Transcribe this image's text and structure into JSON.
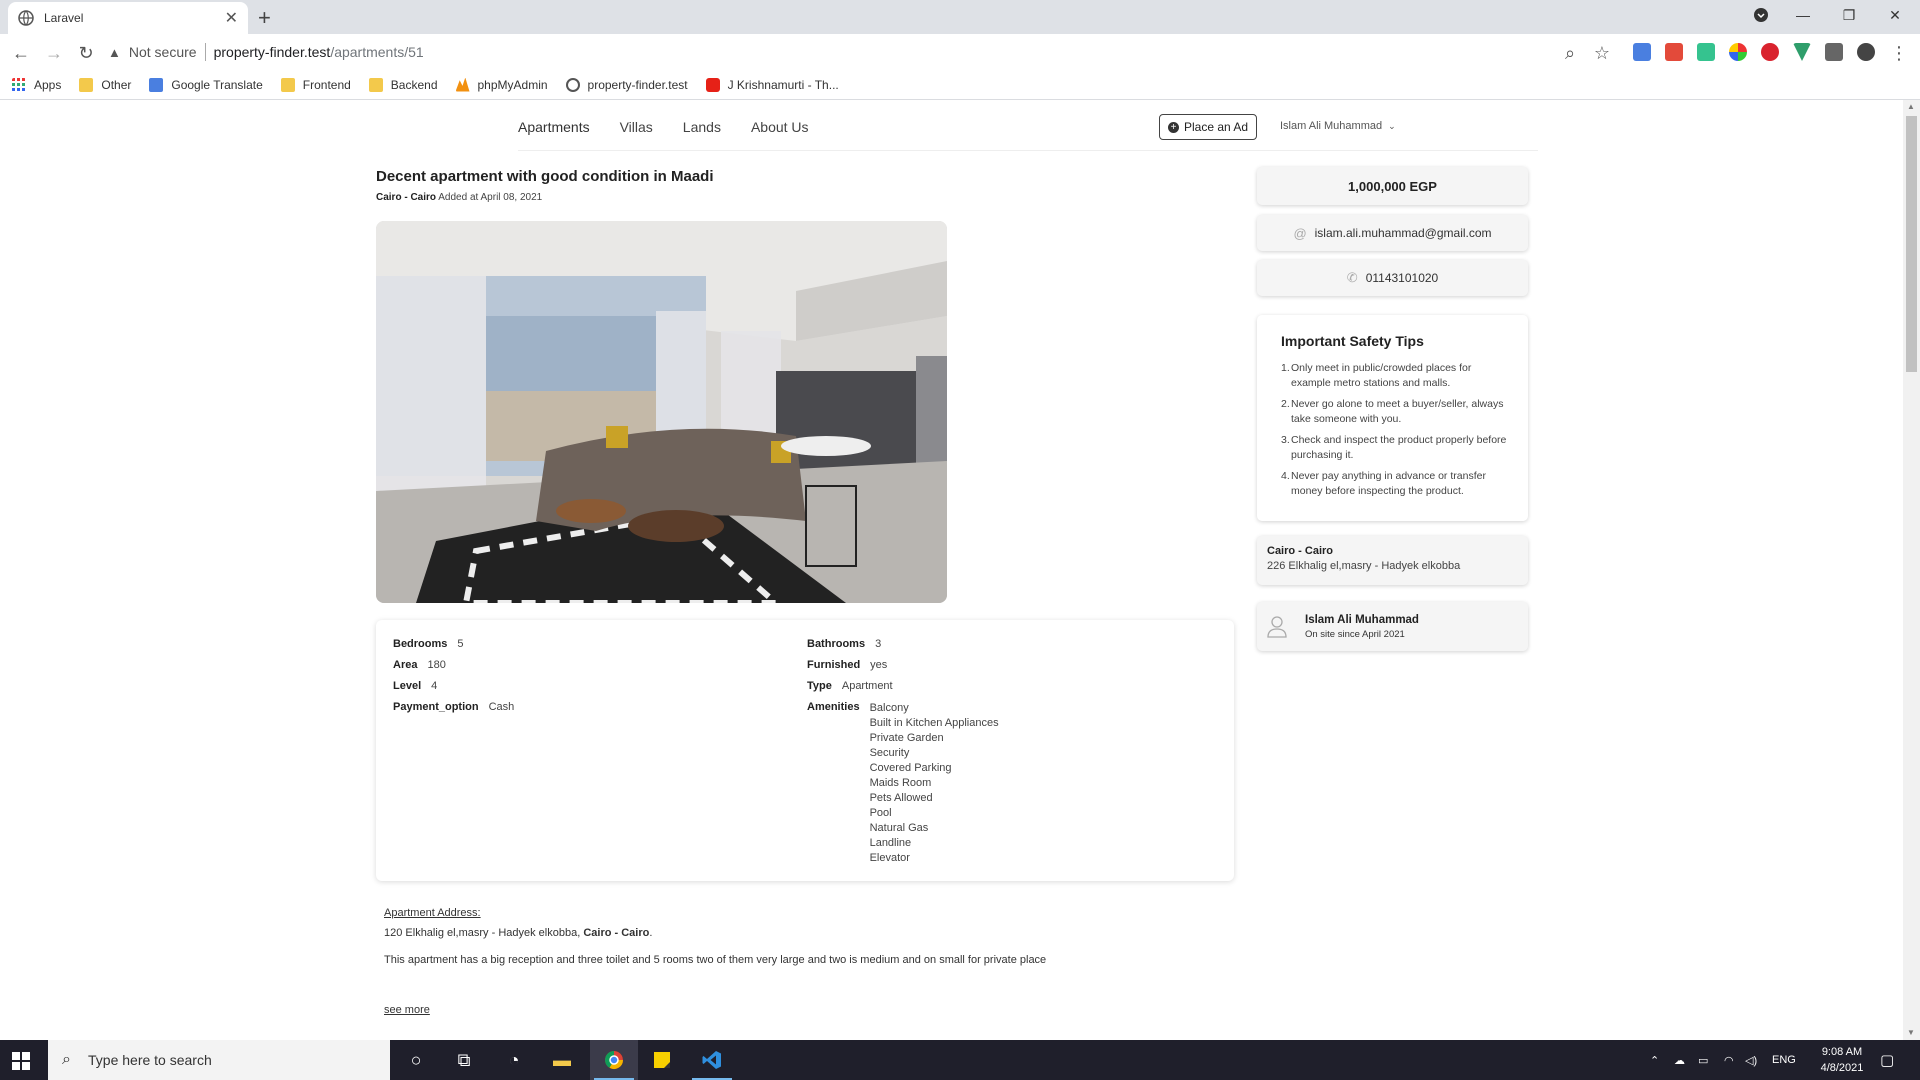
{
  "browser": {
    "tab_title": "Laravel",
    "address": {
      "security_label": "Not secure",
      "host": "property-finder.test",
      "path": "/apartments/51"
    },
    "bookmarks": [
      "Apps",
      "Other",
      "Google Translate",
      "Frontend",
      "Backend",
      "phpMyAdmin",
      "property-finder.test",
      "J Krishnamurti - Th..."
    ]
  },
  "site_nav": {
    "links": [
      "Apartments",
      "Villas",
      "Lands",
      "About Us"
    ],
    "place_ad": "Place an Ad",
    "user": "Islam Ali Muhammad"
  },
  "listing": {
    "title": "Decent apartment with good condition in Maadi",
    "location": "Cairo - Cairo",
    "added": "Added at April 08, 2021",
    "details_left": [
      {
        "key": "Bedrooms",
        "value": "5"
      },
      {
        "key": "Area",
        "value": "180"
      },
      {
        "key": "Level",
        "value": "4"
      },
      {
        "key": "Payment_option",
        "value": "Cash"
      }
    ],
    "details_right": [
      {
        "key": "Bathrooms",
        "value": "3"
      },
      {
        "key": "Furnished",
        "value": "yes"
      },
      {
        "key": "Type",
        "value": "Apartment"
      }
    ],
    "amenities_label": "Amenities",
    "amenities": [
      "Balcony",
      "Built in Kitchen Appliances",
      "Private Garden",
      "Security",
      "Covered Parking",
      "Maids Room",
      "Pets Allowed",
      "Pool",
      "Natural Gas",
      "Landline",
      "Elevator"
    ],
    "address_heading": "Apartment Address:",
    "address_street": "120 Elkhalig el,masry - Hadyek elkobba,",
    "address_city": "Cairo - Cairo",
    "address_end": ".",
    "description": "This apartment has a big reception and three toilet and 5 rooms two of them very large and two is medium and on small for private place",
    "see_more": "see more"
  },
  "sidebar": {
    "price": "1,000,000 EGP",
    "email": "islam.ali.muhammad@gmail.com",
    "phone": "01143101020",
    "tips_title": "Important Safety Tips",
    "tips": [
      "Only meet in public/crowded places for example metro stations and malls.",
      "Never go alone to meet a buyer/seller, always take someone with you.",
      "Check and inspect the product properly before purchasing it.",
      "Never pay anything in advance or transfer money before inspecting the product."
    ],
    "location_city": "Cairo - Cairo",
    "location_street": "226 Elkhalig el,masry - Hadyek elkobba",
    "owner_name": "Islam Ali Muhammad",
    "owner_since": "On site since April 2021"
  },
  "taskbar": {
    "search_placeholder": "Type here to search",
    "language": "ENG",
    "time": "9:08 AM",
    "date": "4/8/2021"
  },
  "colors": {
    "taskbar": "#1f1f2b",
    "chrome_tabstrip": "#dee1e6",
    "card_bg": "#f5f5f5"
  }
}
